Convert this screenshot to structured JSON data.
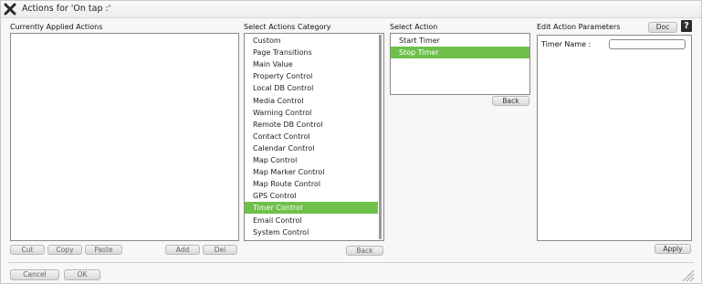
{
  "dialog": {
    "title": "Actions for 'On tap :'"
  },
  "panels": {
    "applied": {
      "heading": "Currently Applied Actions"
    },
    "category": {
      "heading": "Select Actions Category",
      "items": [
        "Custom",
        "Page Transitions",
        "Main Value",
        "Property Control",
        "Local DB Control",
        "Media Control",
        "Warning Control",
        "Remote DB Control",
        "Contact Control",
        "Calendar Control",
        "Map Control",
        "Map Marker Control",
        "Map Route Control",
        "GPS Control",
        "Timer Control",
        "Email Control",
        "System Control"
      ],
      "selected": "Timer Control"
    },
    "action": {
      "heading": "Select Action",
      "items": [
        "Start Timer",
        "Stop Timer"
      ],
      "selected": "Stop Timer"
    },
    "params": {
      "heading": "Edit Action Parameters",
      "field_label": "Timer Name :",
      "field_value": ""
    }
  },
  "buttons": {
    "cut": "Cut",
    "copy": "Copy",
    "paste": "Paste",
    "add": "Add",
    "del": "Del",
    "back_category": "Back",
    "back_action": "Back",
    "doc": "Doc",
    "help": "?",
    "apply": "Apply",
    "cancel": "Cancel",
    "ok": "OK"
  },
  "colors": {
    "selected": "#6ec04a"
  },
  "icons": {
    "close": "close-icon",
    "help": "help-icon",
    "resize": "resize-grip-icon"
  }
}
